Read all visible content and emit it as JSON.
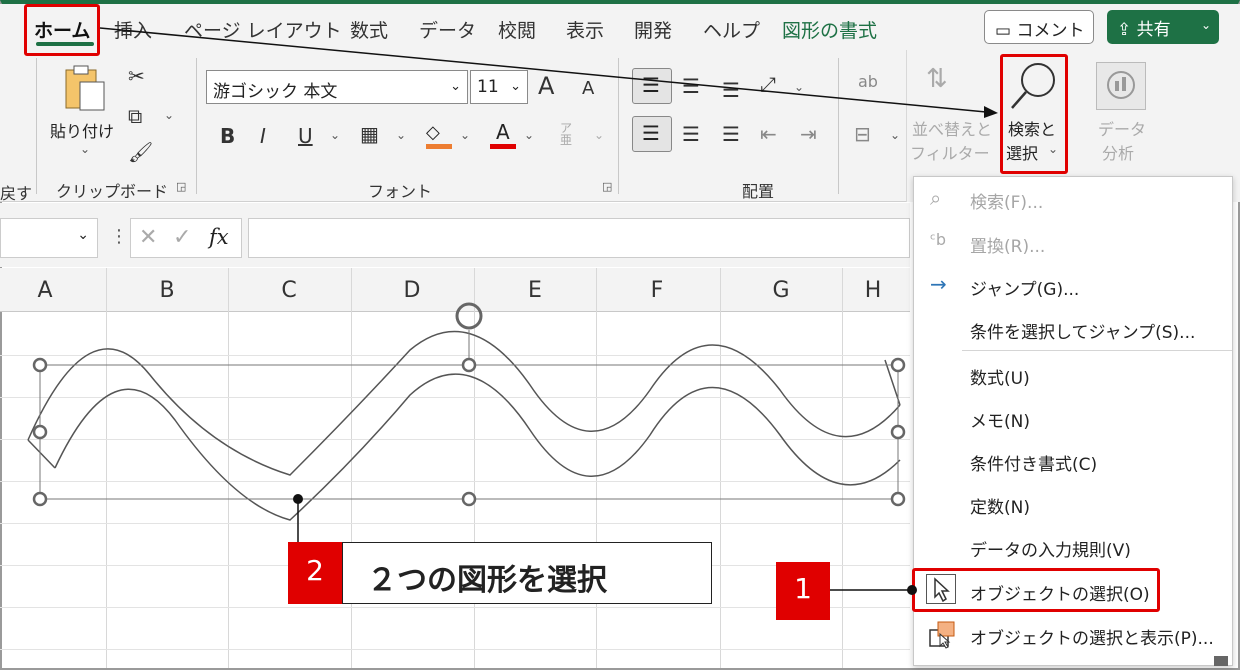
{
  "tabs": [
    {
      "label": "ホーム"
    },
    {
      "label": "挿入"
    },
    {
      "label": "ページ レイアウト"
    },
    {
      "label": "数式"
    },
    {
      "label": "データ"
    },
    {
      "label": "校閲"
    },
    {
      "label": "表示"
    },
    {
      "label": "開発"
    },
    {
      "label": "ヘルプ"
    },
    {
      "label": "図形の書式"
    }
  ],
  "header": {
    "comment_label": "コメント",
    "share_label": "共有"
  },
  "ribbon": {
    "clipboard": {
      "paste_label": "貼り付け",
      "group_label": "クリップボード",
      "left_fragment": "戻す"
    },
    "font": {
      "font_name": "游ゴシック 本文",
      "font_size": "11",
      "group_label": "フォント",
      "bold": "B",
      "italic": "I",
      "underline": "U",
      "font_color_letter": "A",
      "grow": "A",
      "shrink": "A",
      "phonetic": "ア亜"
    },
    "alignment": {
      "group_label": "配置"
    },
    "editing": {
      "sort_label_1": "並べ替えと",
      "sort_label_2": "フィルター",
      "find_label_1": "検索と",
      "find_label_2": "選択",
      "analyze_label_1": "データ",
      "analyze_label_2": "分析"
    }
  },
  "formula_bar": {
    "fx": "fx"
  },
  "columns": [
    "A",
    "B",
    "C",
    "D",
    "E",
    "F",
    "G",
    "H"
  ],
  "menu": {
    "items": [
      {
        "label": "検索(F)...",
        "enabled": false
      },
      {
        "label": "置換(R)...",
        "enabled": false
      },
      {
        "label": "ジャンプ(G)...",
        "enabled": true
      },
      {
        "label": "条件を選択してジャンプ(S)...",
        "enabled": true
      },
      {
        "label": "数式(U)",
        "enabled": true
      },
      {
        "label": "メモ(N)",
        "enabled": true
      },
      {
        "label": "条件付き書式(C)",
        "enabled": true
      },
      {
        "label": "定数(N)",
        "enabled": true
      },
      {
        "label": "データの入力規則(V)",
        "enabled": true
      },
      {
        "label": "オブジェクトの選択(O)",
        "enabled": true
      },
      {
        "label": "オブジェクトの選択と表示(P)...",
        "enabled": true
      }
    ]
  },
  "callouts": {
    "step1_number": "1",
    "step2_number": "2",
    "step2_text": "２つの図形を選択"
  },
  "colors": {
    "excel_green": "#1e7145",
    "highlight_red": "#e00000"
  }
}
